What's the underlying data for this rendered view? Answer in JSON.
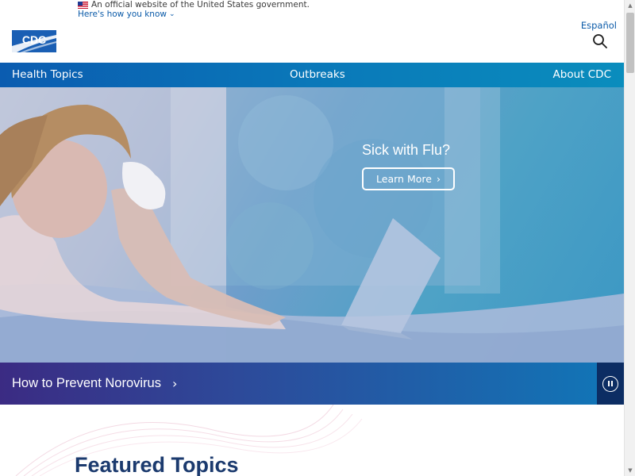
{
  "gov_banner": {
    "official_text": "An official website of the United States government.",
    "how_you_know": "Here's how you know"
  },
  "header": {
    "logo_text": "CDC",
    "language_link": "Español"
  },
  "nav": {
    "items": [
      "Health Topics",
      "Outbreaks",
      "About CDC"
    ]
  },
  "hero": {
    "title": "Sick with Flu?",
    "cta_label": "Learn More"
  },
  "carousel": {
    "caption": "How to Prevent Norovirus"
  },
  "featured": {
    "title": "Featured Topics"
  },
  "colors": {
    "nav_start": "#0b5cb0",
    "nav_end": "#0a8dbd",
    "caption_start": "#3b2b83",
    "caption_end": "#1274b6",
    "pause_bg": "#0c2d63",
    "link": "#0a5aa8",
    "heading": "#1b3a6e"
  },
  "icons": [
    "us-flag-icon",
    "chevron-down-icon",
    "search-icon",
    "chevron-right-icon",
    "pause-icon"
  ]
}
